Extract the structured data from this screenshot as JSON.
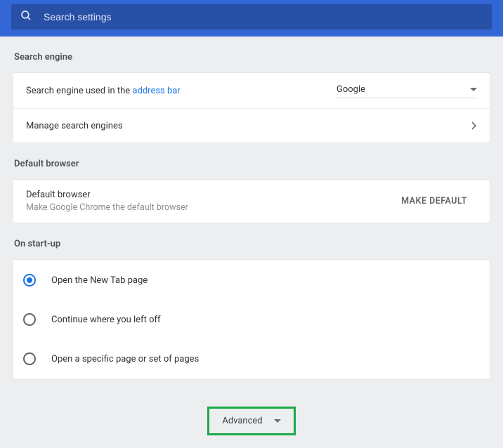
{
  "search": {
    "placeholder": "Search settings"
  },
  "sections": {
    "searchEngine": {
      "heading": "Search engine",
      "row1Prefix": "Search engine used in the ",
      "row1Link": "address bar",
      "selected": "Google",
      "manageLabel": "Manage search engines"
    },
    "defaultBrowser": {
      "heading": "Default browser",
      "title": "Default browser",
      "sub": "Make Google Chrome the default browser",
      "button": "MAKE DEFAULT"
    },
    "startup": {
      "heading": "On start-up",
      "options": [
        {
          "label": "Open the New Tab page",
          "selected": true
        },
        {
          "label": "Continue where you left off",
          "selected": false
        },
        {
          "label": "Open a specific page or set of pages",
          "selected": false
        }
      ]
    }
  },
  "advanced": {
    "label": "Advanced"
  }
}
